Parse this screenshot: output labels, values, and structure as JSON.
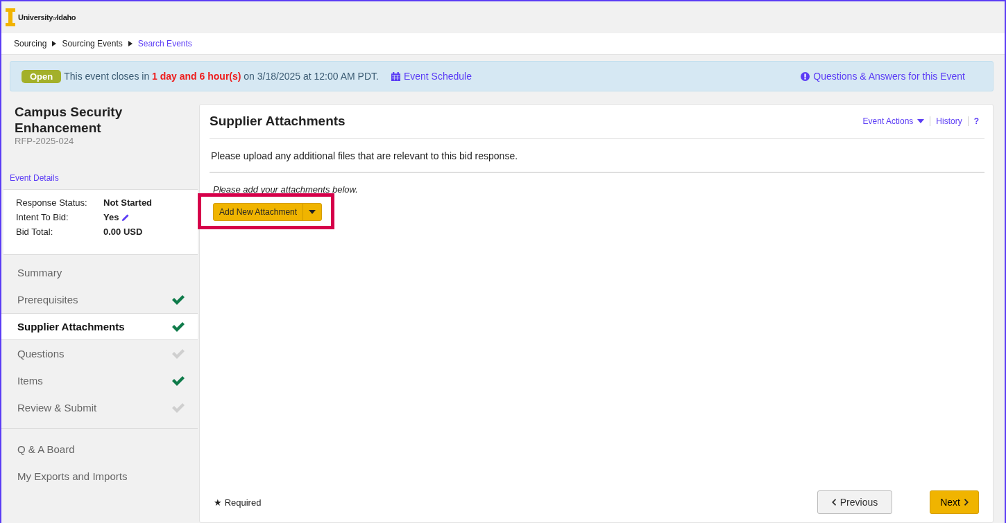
{
  "header": {
    "logo_text": "University",
    "logo_small": "of",
    "logo_text_2": "Idaho"
  },
  "breadcrumb": [
    {
      "label": "Sourcing",
      "link": false
    },
    {
      "label": "Sourcing Events",
      "link": false
    },
    {
      "label": "Search Events",
      "link": true
    }
  ],
  "banner": {
    "status": "Open",
    "message": "This event closes in **1 day and 6 hour(s)** on 3/18/2025 at 12:00 AM PDT.",
    "schedule_link": "Event Schedule",
    "qa_link": "Questions & Answers for this Event"
  },
  "event": {
    "title": "Campus Security Enhancement",
    "id": "RFP-2025-024",
    "details_link": "Event Details"
  },
  "summary": [
    {
      "label": "Response Status:",
      "value": "Not Started",
      "editable": false
    },
    {
      "label": "Intent To Bid:",
      "value": "Yes",
      "editable": true
    },
    {
      "label": "Bid Total:",
      "value": "0.00 USD",
      "editable": false
    }
  ],
  "nav": [
    {
      "label": "Summary",
      "selected": false
    },
    {
      "label": "Prerequisites",
      "selected": false,
      "complete": true
    },
    {
      "label": "Supplier Attachments",
      "selected": true,
      "complete": true
    },
    {
      "label": "Questions",
      "selected": false,
      "complete": false
    },
    {
      "label": "Items",
      "selected": false,
      "complete": true
    },
    {
      "label": "Review & Submit",
      "selected": false,
      "complete": false
    }
  ],
  "nav_extra": [
    "Q & A Board",
    "My Exports and Imports"
  ],
  "main": {
    "title": "Supplier Attachments",
    "actions": "Event Actions",
    "history": "History",
    "help": "?",
    "intro": "Please upload any additional files that are relevant to this bid response.",
    "hint": "Please add your attachments below.",
    "add_button": "Add New Attachment",
    "highlighted": true,
    "required_mark": "★",
    "required": "Required",
    "previous": "Previous",
    "next": "Next"
  }
}
